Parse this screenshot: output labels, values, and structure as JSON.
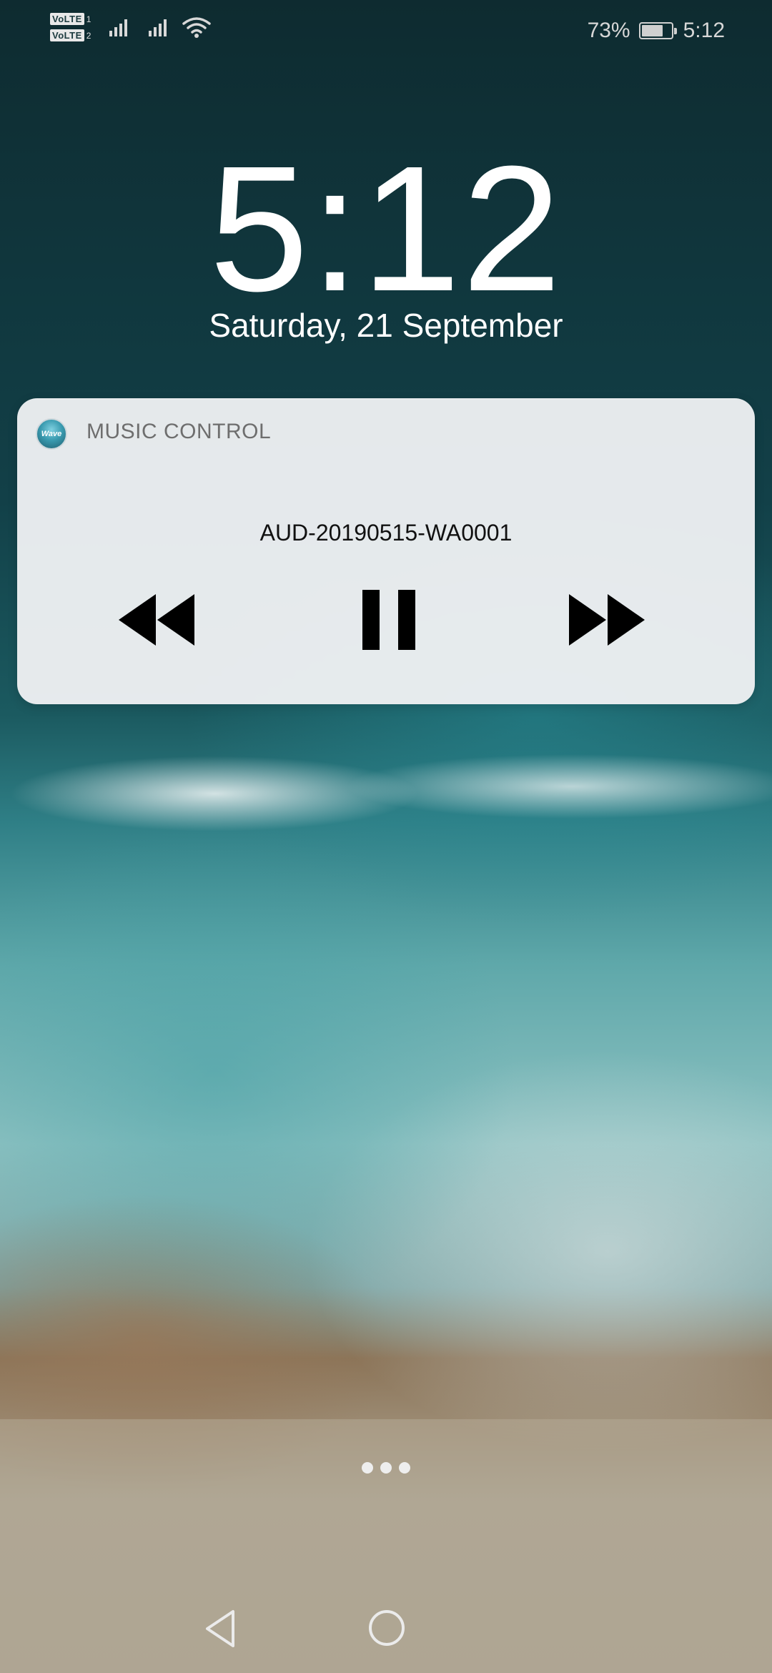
{
  "status_bar": {
    "sim1_label": "VoLTE",
    "sim1_num": "1",
    "sim2_label": "VoLTE",
    "sim2_num": "2",
    "battery_percent": "73%",
    "battery_level": 0.73,
    "time": "5:12",
    "icons": [
      "signal-icon",
      "signal-icon",
      "wifi-icon",
      "battery-icon"
    ]
  },
  "lockscreen": {
    "clock": "5:12",
    "date": "Saturday, 21 September"
  },
  "notification": {
    "app_icon_text": "Wave",
    "app_name": "MUSIC CONTROL",
    "track_title": "AUD-20190515-WA0001",
    "controls": [
      "rewind-icon",
      "pause-icon",
      "fast-forward-icon"
    ]
  },
  "navigation": {
    "icons": [
      "back-icon",
      "home-icon"
    ]
  },
  "colors": {
    "card_background": "#eef0f2",
    "control_icon": "#000000",
    "app_name_text": "#6e6e6e"
  }
}
